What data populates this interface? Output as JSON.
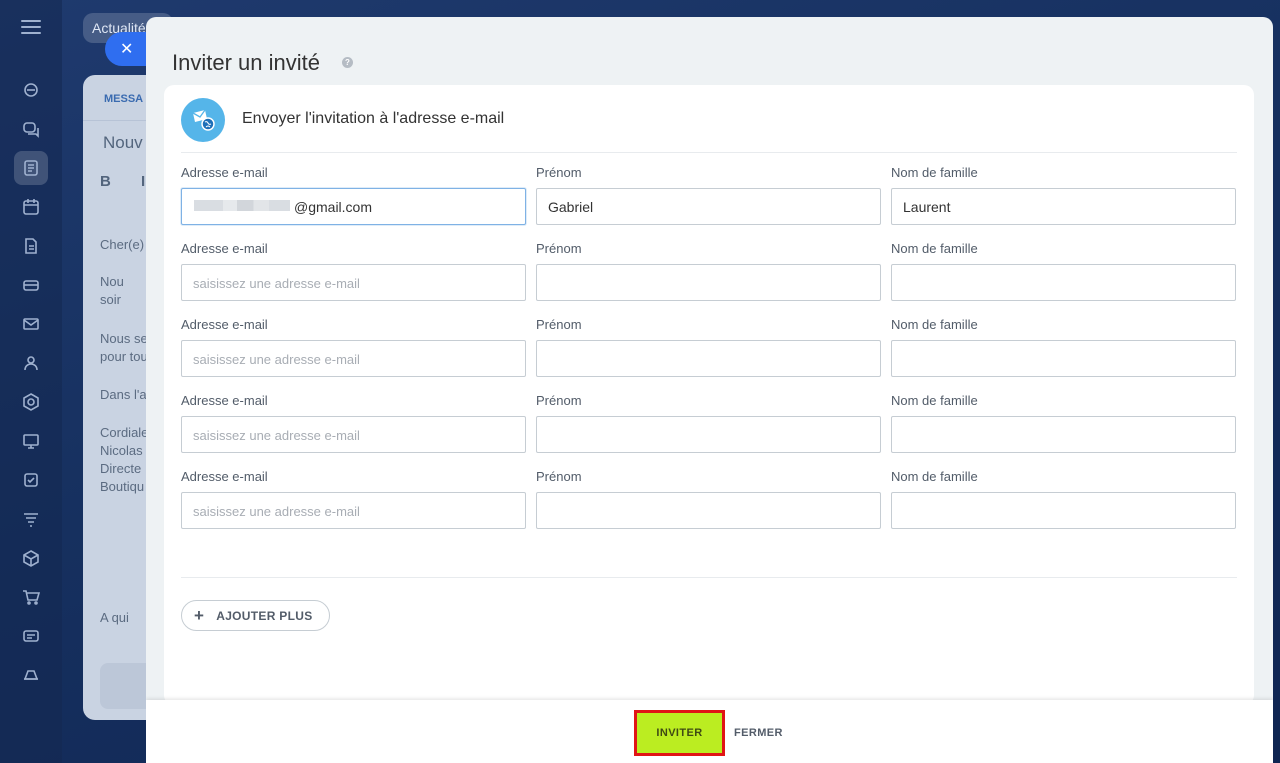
{
  "background": {
    "tab_label": "Actualité",
    "message_tab": "MESSA",
    "page_title": "Nouv",
    "toolbar": "B I",
    "body_lines": [
      "Cher(e)",
      "Nou",
      "soir",
      "Nous se",
      "pour tou",
      "Dans l'a",
      "Cordiale",
      "Nicolas",
      "Directe",
      "Boutiqu"
    ],
    "footer_line": "A qui"
  },
  "modal": {
    "title": "Inviter un invité",
    "help_icon": "question-icon",
    "section_title": "Envoyer l'invitation à l'adresse e-mail",
    "section_icon": "email-invite-icon",
    "labels": {
      "email": "Adresse e-mail",
      "first_name": "Prénom",
      "last_name": "Nom de famille"
    },
    "rows": [
      {
        "email": "@gmail.com",
        "email_redacted": true,
        "first_name": "Gabriel",
        "last_name": "Laurent"
      },
      {
        "email": "",
        "first_name": "",
        "last_name": ""
      },
      {
        "email": "",
        "first_name": "",
        "last_name": ""
      },
      {
        "email": "",
        "first_name": "",
        "last_name": ""
      },
      {
        "email": "",
        "first_name": "",
        "last_name": ""
      }
    ],
    "email_placeholder": "saisissez une adresse e-mail",
    "add_more_label": "AJOUTER PLUS",
    "invite_label": "INVITER",
    "close_label": "FERMER"
  },
  "colors": {
    "invite_button": "#bbed21",
    "highlight_border": "#e01515",
    "accent_blue": "#2f6ef0",
    "section_icon_bg": "#55b5e9"
  }
}
